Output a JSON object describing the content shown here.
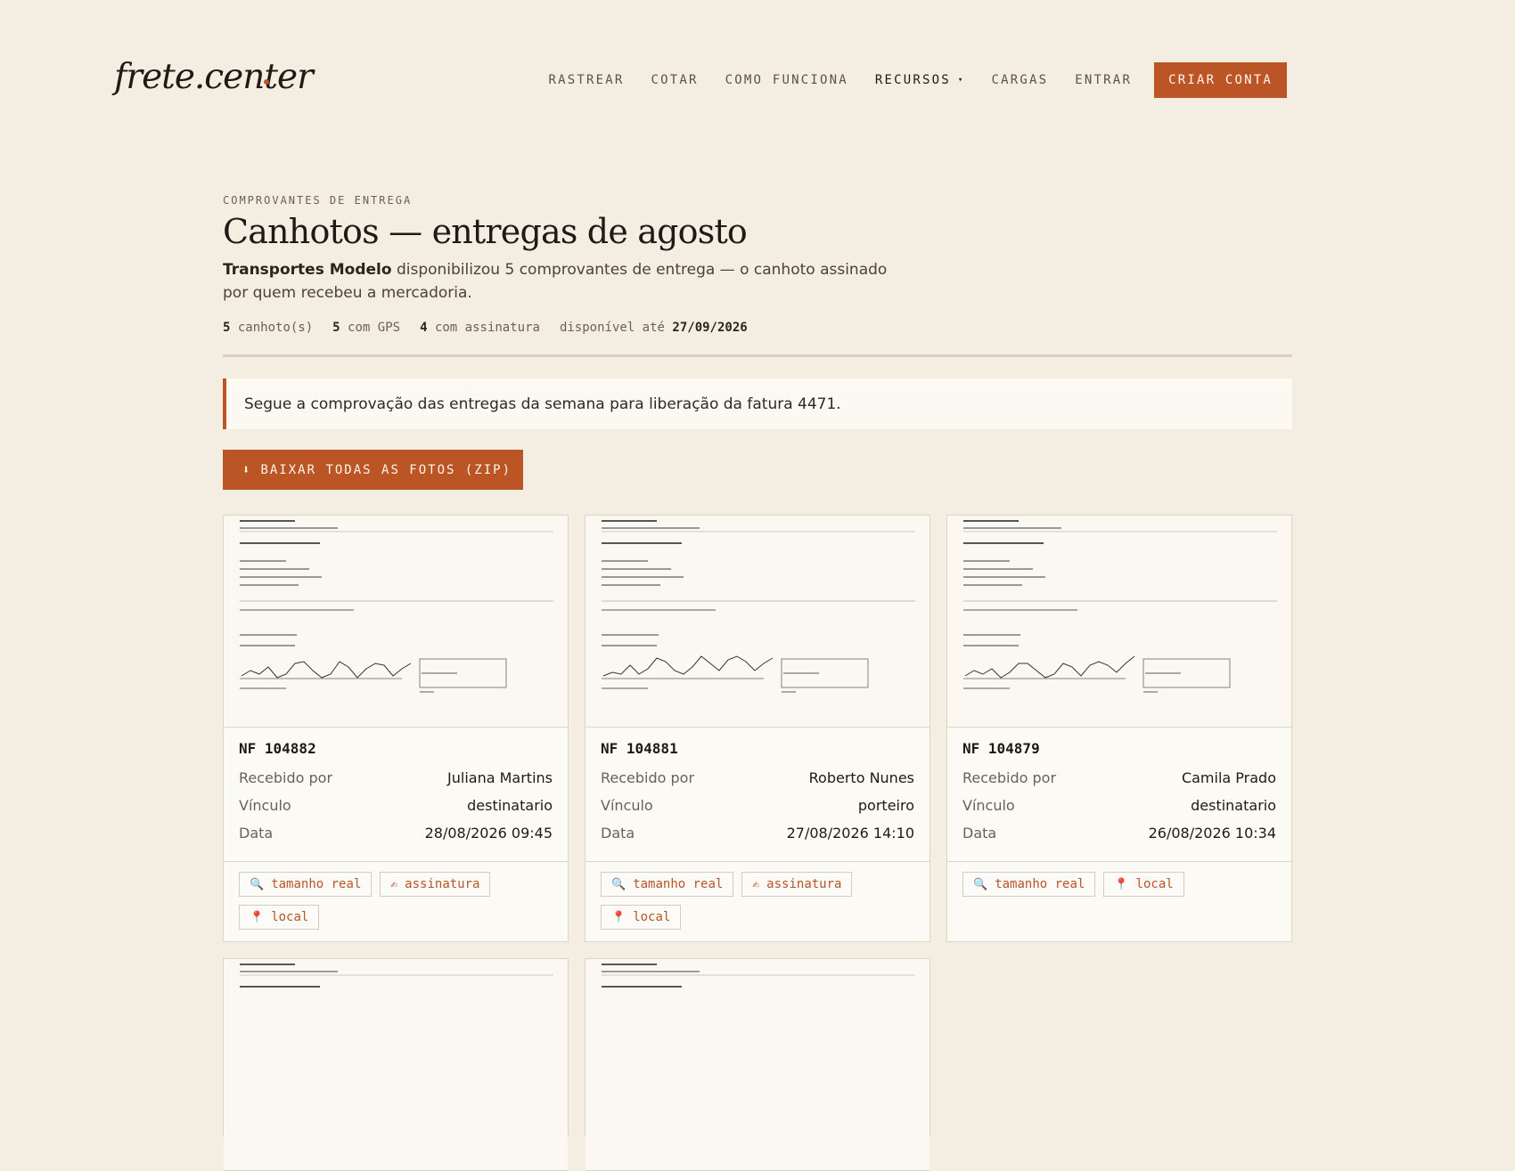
{
  "brand": {
    "logo": "frete.center"
  },
  "nav": {
    "items": [
      {
        "label": "RASTREAR"
      },
      {
        "label": "COTAR"
      },
      {
        "label": "COMO FUNCIONA"
      },
      {
        "label": "RECURSOS"
      },
      {
        "label": "CARGAS"
      },
      {
        "label": "ENTRAR"
      }
    ],
    "caret": "▾",
    "cta": "CRIAR CONTA"
  },
  "page": {
    "eyebrow": "COMPROVANTES DE ENTREGA",
    "title": "Canhotos — entregas de agosto",
    "company": "Transportes Modelo",
    "lead_rest": " disponibilizou 5 comprovantes de entrega — o canhoto assinado por quem recebeu a mercadoria.",
    "stats": {
      "canhotos_count": "5",
      "canhotos_label": "canhoto(s)",
      "gps_count": "5",
      "gps_label": "com GPS",
      "assinatura_count": "4",
      "assinatura_label": "com assinatura",
      "disponivel_label": "disponível até",
      "disponivel_date": "27/09/2026"
    },
    "note": "Segue a comprovação das entregas da semana para liberação da fatura 4471.",
    "zip_icon": "⬇",
    "zip_label": "BAIXAR TODAS AS FOTOS (ZIP)"
  },
  "labels": {
    "recebido": "Recebido por",
    "vinculo": "Vínculo",
    "data": "Data"
  },
  "chips": {
    "tamanho": {
      "icon": "🔍",
      "label": "tamanho real"
    },
    "assinatura": {
      "icon": "✍",
      "label": "assinatura"
    },
    "local": {
      "icon": "📍",
      "label": "local"
    }
  },
  "cards": [
    {
      "nf": "NF 104882",
      "recebido": "Juliana Martins",
      "vinculo": "destinatario",
      "data": "28/08/2026 09:45"
    },
    {
      "nf": "NF 104881",
      "recebido": "Roberto Nunes",
      "vinculo": "porteiro",
      "data": "27/08/2026 14:10"
    },
    {
      "nf": "NF 104879",
      "recebido": "Camila Prado",
      "vinculo": "destinatario",
      "data": "26/08/2026 10:34"
    }
  ],
  "colors": {
    "accent": "#bc5526",
    "background": "#f3ede2",
    "card": "#fcfaf5"
  },
  "icons": {
    "zip": "download-icon",
    "tamanho": "magnifier-icon",
    "assinatura": "writing-hand-icon",
    "local": "pin-icon"
  }
}
